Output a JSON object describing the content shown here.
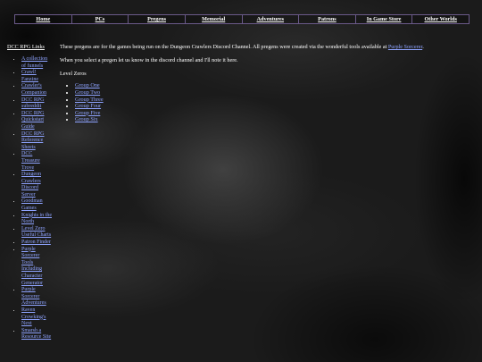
{
  "nav": {
    "items": [
      "Home",
      "PCs",
      "Pregens",
      "Memorial",
      "Adventures",
      "Patrons",
      "In Game Store",
      "Other Worlds"
    ]
  },
  "sidebar": {
    "title": "DCC RPG Links",
    "links": [
      "A collection of funnels",
      "Crawl! Fanzine",
      "Crawler's Companion",
      "DCC RPG subreddit",
      "DCC RPG Quickstart Guide",
      "DCC RPG Reference Sheets",
      "DCC Treasure Trove",
      "Dungeon Crawlers Discord Server",
      "Goodman Games",
      "Knights in the North",
      "Level Zero Useful Charts",
      "Patron Finder",
      "Purple Sorcerer Tools Including Character Generator",
      "Purple Sorcerer Adventures",
      "Raven Crowking's Next",
      "Smarsh a Resource Site"
    ]
  },
  "main": {
    "intro_before_link": "These pregens are for the games being run on the Dungeon Crawlers Discord Channel. All pregens were created via the wonderful tools available at",
    "intro_link": "Purple Sorcerer",
    "intro_after_link": ".",
    "select_note": "When you select a pregen let us know in the discord channel and I'll note it here.",
    "level_heading": "Level Zeros",
    "groups": [
      "Group One",
      "Group Two",
      "Group Three",
      "Group Four",
      "Group Five",
      "Group Six"
    ]
  },
  "colors": {
    "link": "#8ea3ff",
    "text": "#ffffff",
    "nav_border": "#6b5a8a",
    "background": "#1b1b1b"
  }
}
